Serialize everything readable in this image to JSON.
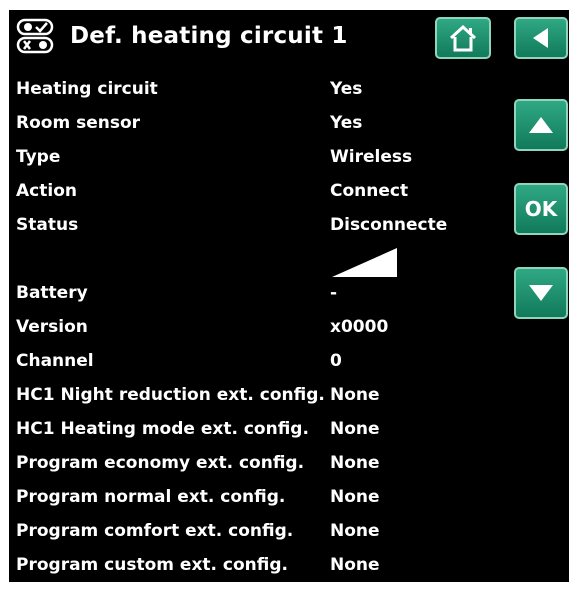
{
  "header": {
    "title": "Def. heating circuit 1",
    "icon": "toggle-switches-icon"
  },
  "nav": {
    "home_icon": "home-icon",
    "back_icon": "back-arrow-icon",
    "up_icon": "up-arrow-icon",
    "ok_label": "OK",
    "down_icon": "down-arrow-icon"
  },
  "rows": [
    {
      "label": "Heating circuit",
      "value": "Yes"
    },
    {
      "label": "Room sensor",
      "value": "Yes"
    },
    {
      "label": "Type",
      "value": "Wireless"
    },
    {
      "label": "Action",
      "value": "Connect"
    },
    {
      "label": "Status",
      "value": "Disconnected"
    },
    {
      "label": "",
      "value": ""
    },
    {
      "label": "Battery",
      "value": "-"
    },
    {
      "label": "Version",
      "value": "x0000"
    },
    {
      "label": "Channel",
      "value": "0"
    },
    {
      "label": "HC1 Night reduction ext. config.",
      "value": "None"
    },
    {
      "label": "HC1 Heating mode ext. config.",
      "value": "None"
    },
    {
      "label": "Program economy ext. config.",
      "value": "None"
    },
    {
      "label": "Program normal ext. config.",
      "value": "None"
    },
    {
      "label": "Program comfort ext. config.",
      "value": "None"
    },
    {
      "label": "Program custom ext. config.",
      "value": "None"
    }
  ],
  "signal": {
    "icon": "signal-strength-icon",
    "level": 1.0
  },
  "colors": {
    "background": "#000000",
    "button": "#1e9170",
    "text": "#ffffff"
  }
}
